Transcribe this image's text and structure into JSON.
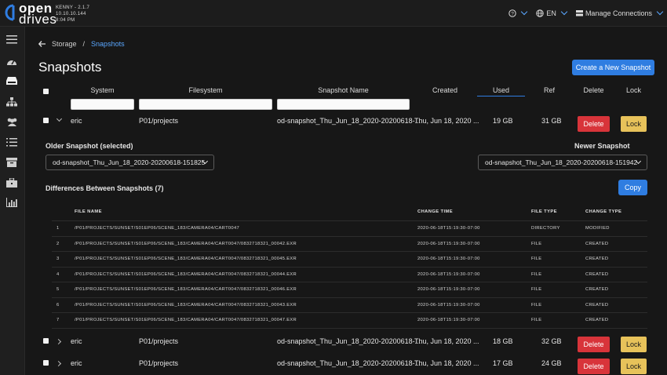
{
  "app": {
    "logo_line1": "open",
    "logo_line2": "drives",
    "build_line1": "KENNY - 2.1.7",
    "build_line2": "10.10.10.144",
    "build_line3": "8:04 PM",
    "language": "EN",
    "manage_connections": "Manage Connections",
    "accent": "#2f7de1"
  },
  "breadcrumb": {
    "parent": "Storage",
    "separator": "/",
    "current": "Snapshots"
  },
  "page_title": "Snapshots",
  "create_button": "Create a New Snapshot",
  "columns": {
    "system": "System",
    "filesystem": "Filesystem",
    "snapshot_name": "Snapshot Name",
    "created": "Created",
    "used": "Used",
    "ref": "Ref",
    "delete": "Delete",
    "lock": "Lock"
  },
  "rows": [
    {
      "system": "eric",
      "filesystem": "P01/projects",
      "name": "od-snapshot_Thu_Jun_18_2020-20200618-...",
      "created": "Thu, Jun 18, 2020 ...",
      "used": "19 GB",
      "ref": "31 GB",
      "delete": "Delete",
      "lock": "Lock"
    },
    {
      "system": "eric",
      "filesystem": "P01/projects",
      "name": "od-snapshot_Thu_Jun_18_2020-20200618-...",
      "created": "Thu, Jun 18, 2020 ...",
      "used": "18 GB",
      "ref": "32 GB",
      "delete": "Delete",
      "lock": "Lock"
    },
    {
      "system": "eric",
      "filesystem": "P01/projects",
      "name": "od-snapshot_Thu_Jun_18_2020-20200618-...",
      "created": "Thu, Jun 18, 2020 ...",
      "used": "17 GB",
      "ref": "24 GB",
      "delete": "Delete",
      "lock": "Lock"
    }
  ],
  "compare": {
    "older_label": "Older Snapshot (selected)",
    "older_value": "od-snapshot_Thu_Jun_18_2020-20200618-151825",
    "newer_label": "Newer Snapshot",
    "newer_value": "od-snapshot_Thu_Jun_18_2020-20200618-151942",
    "diff_title": "Differences Between Snapshots (7)",
    "copy": "Copy"
  },
  "diff": {
    "headers": {
      "file_name": "FILE NAME",
      "change_time": "CHANGE TIME",
      "file_type": "FILE TYPE",
      "change_type": "CHANGE TYPE"
    },
    "rows": [
      {
        "n": "1",
        "file": "/P01/PROJECTS/SUNSET/S01EP06/SCENE_183/CAMERA04/CART0047",
        "time": "2020-06-18T15:19:30-07:00",
        "type": "DIRECTORY",
        "change": "MODIFIED"
      },
      {
        "n": "2",
        "file": "/P01/PROJECTS/SUNSET/S01EP06/SCENE_183/CAMERA04/CART0047/0832718321_00042.EXR",
        "time": "2020-06-18T15:19:30-07:00",
        "type": "FILE",
        "change": "CREATED"
      },
      {
        "n": "3",
        "file": "/P01/PROJECTS/SUNSET/S01EP06/SCENE_183/CAMERA04/CART0047/0832718321_00045.EXR",
        "time": "2020-06-18T15:19:30-07:00",
        "type": "FILE",
        "change": "CREATED"
      },
      {
        "n": "4",
        "file": "/P01/PROJECTS/SUNSET/S01EP06/SCENE_183/CAMERA04/CART0047/0832718321_00044.EXR",
        "time": "2020-06-18T15:19:30-07:00",
        "type": "FILE",
        "change": "CREATED"
      },
      {
        "n": "5",
        "file": "/P01/PROJECTS/SUNSET/S01EP06/SCENE_183/CAMERA04/CART0047/0832718321_00046.EXR",
        "time": "2020-06-18T15:19:30-07:00",
        "type": "FILE",
        "change": "CREATED"
      },
      {
        "n": "6",
        "file": "/P01/PROJECTS/SUNSET/S01EP06/SCENE_183/CAMERA04/CART0047/0832718321_00043.EXR",
        "time": "2020-06-18T15:19:30-07:00",
        "type": "FILE",
        "change": "CREATED"
      },
      {
        "n": "7",
        "file": "/P01/PROJECTS/SUNSET/S01EP06/SCENE_183/CAMERA04/CART0047/0832718321_00047.EXR",
        "time": "2020-06-18T15:19:30-07:00",
        "type": "FILE",
        "change": "CREATED"
      }
    ]
  },
  "icons": {
    "help": "help-icon",
    "globe": "globe-icon",
    "menu": "menu-icon",
    "nav": [
      "dashboard-icon",
      "storage-icon",
      "network-icon",
      "users-icon",
      "list-icon",
      "box-icon",
      "briefcase-icon",
      "chart-icon"
    ]
  }
}
